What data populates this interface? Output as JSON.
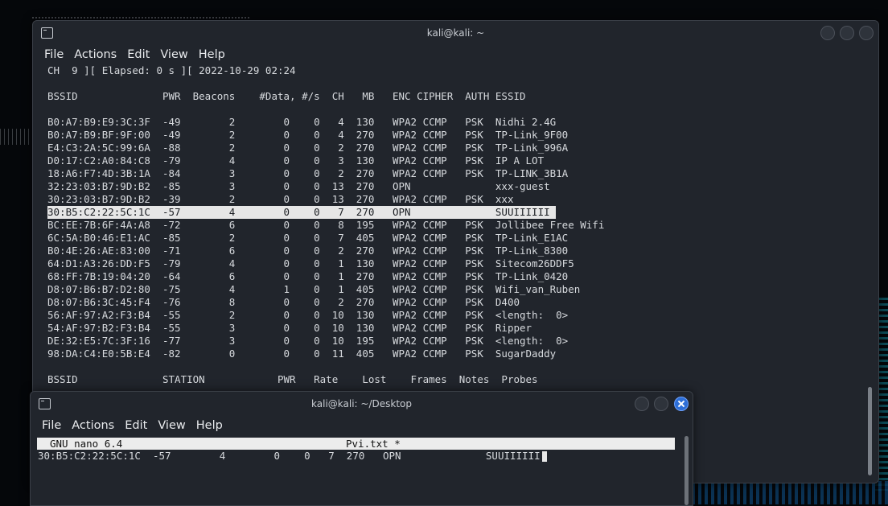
{
  "window1": {
    "title": "kali@kali: ~",
    "menu": [
      "File",
      "Actions",
      "Edit",
      "View",
      "Help"
    ],
    "status_line": "CH  9 ][ Elapsed: 0 s ][ 2022-10-29 02:24",
    "ap_header": "BSSID              PWR  Beacons    #Data, #/s  CH   MB   ENC CIPHER  AUTH ESSID",
    "ap_rows": [
      "B0:A7:B9:E9:3C:3F  -49        2        0    0   4  130   WPA2 CCMP   PSK  Nidhi 2.4G",
      "B0:A7:B9:BF:9F:00  -49        2        0    0   4  270   WPA2 CCMP   PSK  TP-Link_9F00",
      "E4:C3:2A:5C:99:6A  -88        2        0    0   2  270   WPA2 CCMP   PSK  TP-Link_996A",
      "D0:17:C2:A0:84:C8  -79        4        0    0   3  130   WPA2 CCMP   PSK  IP A LOT",
      "18:A6:F7:4D:3B:1A  -84        3        0    0   2  270   WPA2 CCMP   PSK  TP-LINK_3B1A",
      "32:23:03:B7:9D:B2  -85        3        0    0  13  270   OPN              xxx-guest",
      "30:23:03:B7:9D:B2  -39        2        0    0  13  270   WPA2 CCMP   PSK  xxx",
      "30:B5:C2:22:5C:1C  -57        4        0    0   7  270   OPN              SUUIIIIII ",
      "BC:EE:7B:6F:4A:A8  -72        6        0    0   8  195   WPA2 CCMP   PSK  Jollibee Free Wifi",
      "6C:5A:B0:46:E1:AC  -85        2        0    0   7  405   WPA2 CCMP   PSK  TP-Link_E1AC",
      "B0:4E:26:AE:83:00  -71        6        0    0   2  270   WPA2 CCMP   PSK  TP-Link_8300",
      "64:D1:A3:26:DD:F5  -79        4        0    0   1  130   WPA2 CCMP   PSK  Sitecom26DDF5",
      "68:FF:7B:19:04:20  -64        6        0    0   1  270   WPA2 CCMP   PSK  TP-Link_0420",
      "D8:07:B6:B7:D2:80  -75        4        1    0   1  405   WPA2 CCMP   PSK  Wifi_van_Ruben",
      "D8:07:B6:3C:45:F4  -76        8        0    0   2  270   WPA2 CCMP   PSK  D400",
      "56:AF:97:A2:F3:B4  -55        2        0    0  10  130   WPA2 CCMP   PSK  <length:  0>",
      "54:AF:97:B2:F3:B4  -55        3        0    0  10  130   WPA2 CCMP   PSK  Ripper",
      "DE:32:E5:7C:3F:16  -77        3        0    0  10  195   WPA2 CCMP   PSK  <length:  0>",
      "98:DA:C4:E0:5B:E4  -82        0        0    0  11  405   WPA2 CCMP   PSK  SugarDaddy"
    ],
    "station_header": "BSSID              STATION            PWR   Rate    Lost    Frames  Notes  Probes"
  },
  "window2": {
    "title": "kali@kali: ~/Desktop",
    "menu": [
      "File",
      "Actions",
      "Edit",
      "View",
      "Help"
    ],
    "nano_version": "GNU nano 6.4",
    "nano_filename": "Pvi.txt *",
    "content_line": "30:B5:C2:22:5C:1C  -57        4        0    0   7  270   OPN              SUUIIIIII"
  }
}
